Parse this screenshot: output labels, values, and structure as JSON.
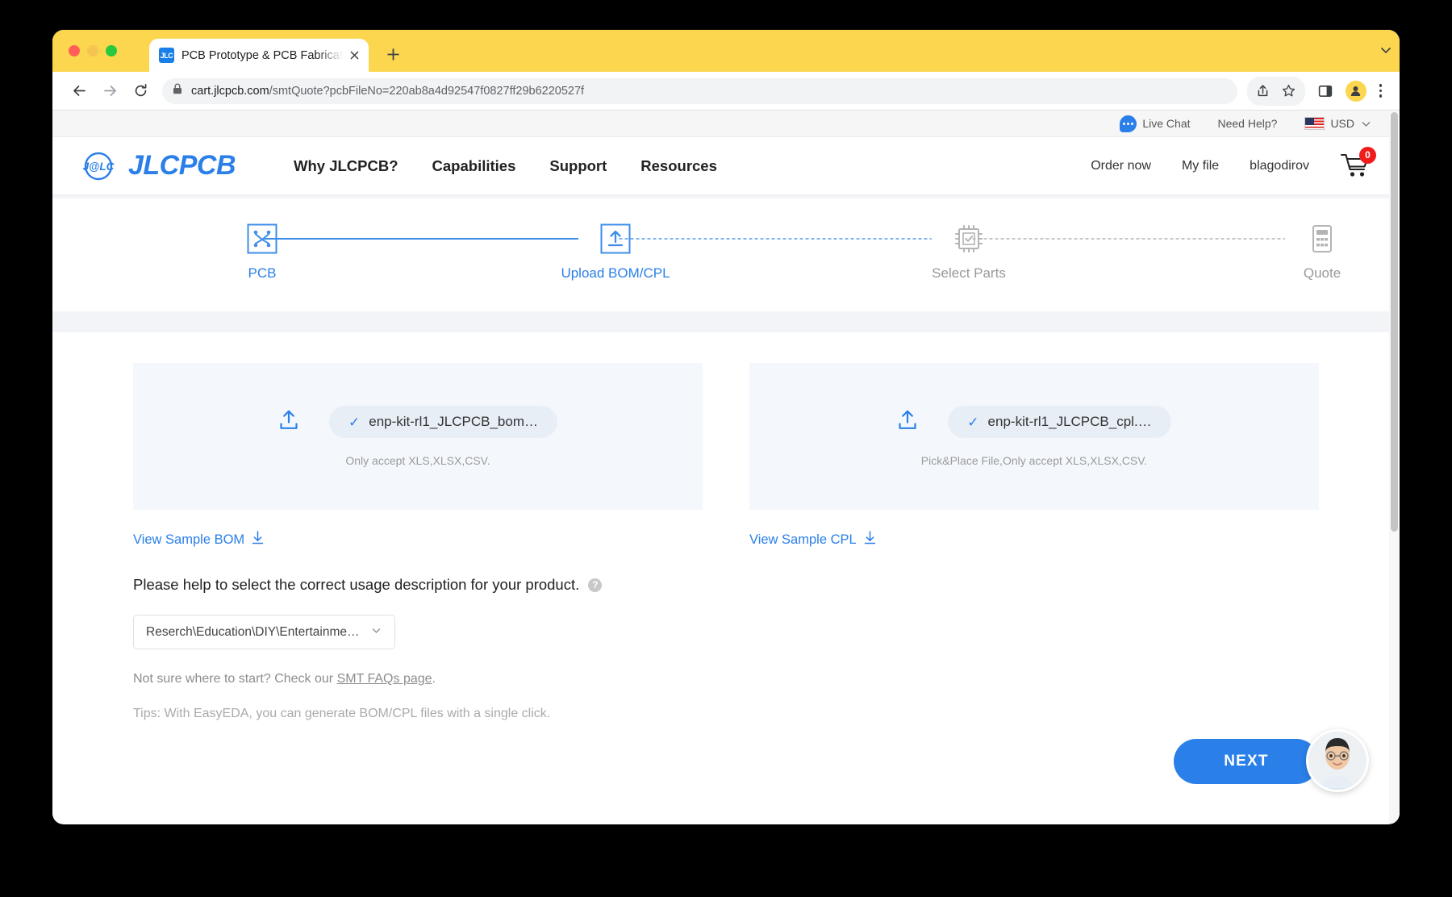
{
  "browser": {
    "tab": {
      "favicon_text": "JLC",
      "title": "PCB Prototype & PCB Fabricati",
      "close_icon": "close-icon"
    },
    "new_tab_label": "+",
    "url_domain": "cart.jlcpcb.com",
    "url_path": "/smtQuote?pcbFileNo=220ab8a4d92547f0827ff29b6220527f",
    "back_label": "←",
    "forward_label": "→",
    "reload_label": "⟳"
  },
  "utility": {
    "live_chat": "Live Chat",
    "need_help": "Need Help?",
    "currency": "USD"
  },
  "nav": {
    "logo_mark": "J@LC",
    "logo_word": "JLCPCB",
    "links": [
      {
        "label": "Why JLCPCB?"
      },
      {
        "label": "Capabilities"
      },
      {
        "label": "Support"
      },
      {
        "label": "Resources"
      }
    ],
    "right_links": [
      {
        "label": "Order now"
      },
      {
        "label": "My file"
      },
      {
        "label": "blagodirov"
      }
    ],
    "cart_count": "0"
  },
  "stepper": {
    "steps": [
      {
        "label": "PCB",
        "icon": "pcb-board-icon",
        "state": "done"
      },
      {
        "label": "Upload BOM/CPL",
        "icon": "upload-icon",
        "state": "active"
      },
      {
        "label": "Select Parts",
        "icon": "chip-check-icon",
        "state": "pending"
      },
      {
        "label": "Quote",
        "icon": "calculator-icon",
        "state": "pending"
      }
    ]
  },
  "uploads": {
    "bom": {
      "file_name": "enp-kit-rl1_JLCPCB_bom…",
      "hint": "Only accept XLS,XLSX,CSV.",
      "sample_link": "View Sample BOM"
    },
    "cpl": {
      "file_name": "enp-kit-rl1_JLCPCB_cpl.…",
      "hint": "Pick&Place File,Only accept XLS,XLSX,CSV.",
      "sample_link": "View Sample CPL"
    }
  },
  "usage": {
    "question": "Please help to select the correct usage description for your product.",
    "help_icon_label": "?",
    "selected_option": "Reserch\\Education\\DIY\\Entertainment…",
    "note_prefix": "Not sure where to start? Check our ",
    "note_link": "SMT FAQs page",
    "note_suffix": ".",
    "tips": "Tips: With EasyEDA, you can generate BOM/CPL files with a single click."
  },
  "actions": {
    "next_label": "NEXT"
  },
  "colors": {
    "brand_blue": "#2a7fe8",
    "accent_yellow": "#fcd64f",
    "cart_badge_red": "#f01c1c",
    "card_bg": "#f4f8fd"
  }
}
